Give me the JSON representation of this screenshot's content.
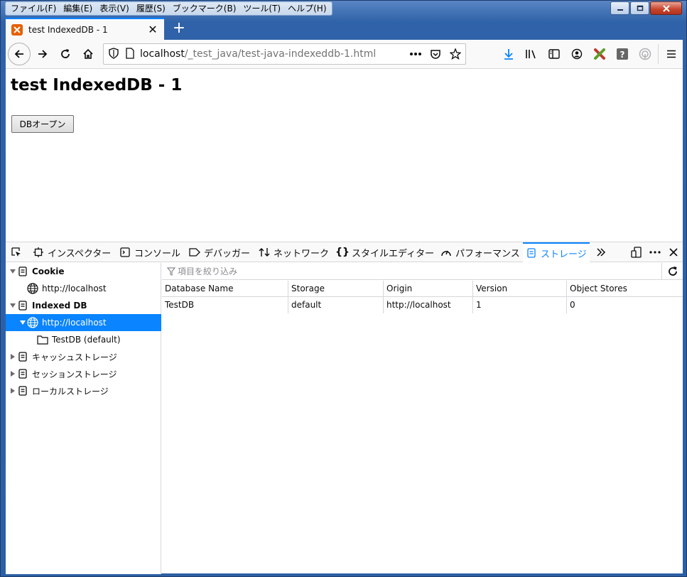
{
  "menu": [
    "ファイル(F)",
    "編集(E)",
    "表示(V)",
    "履歴(S)",
    "ブックマーク(B)",
    "ツール(T)",
    "ヘルプ(H)"
  ],
  "tab": {
    "title": "test IndexedDB - 1"
  },
  "url": {
    "host": "localhost",
    "path": "/_test_java/test-java-indexeddb-1.html"
  },
  "page": {
    "heading": "test IndexedDB - 1",
    "button_label": "DBオープン"
  },
  "devtools": {
    "tabs": [
      "インスペクター",
      "コンソール",
      "デバッガー",
      "ネットワーク",
      "スタイルエディター",
      "パフォーマンス",
      "ストレージ"
    ],
    "active_tab": "ストレージ",
    "tree": [
      {
        "label": "Cookie",
        "level": 0,
        "expanded": true,
        "icon": "storage-icon"
      },
      {
        "label": "http://localhost",
        "level": 1,
        "icon": "globe-icon"
      },
      {
        "label": "Indexed DB",
        "level": 0,
        "expanded": true,
        "icon": "storage-icon"
      },
      {
        "label": "http://localhost",
        "level": 1,
        "expanded": true,
        "selected": true,
        "icon": "globe-icon"
      },
      {
        "label": "TestDB (default)",
        "level": 2,
        "icon": "folder-icon"
      },
      {
        "label": "キャッシュストレージ",
        "level": 0,
        "expanded": false,
        "icon": "storage-icon"
      },
      {
        "label": "セッションストレージ",
        "level": 0,
        "expanded": false,
        "icon": "storage-icon"
      },
      {
        "label": "ローカルストレージ",
        "level": 0,
        "expanded": false,
        "icon": "storage-icon"
      }
    ],
    "filter_placeholder": "項目を絞り込み",
    "table": {
      "columns": [
        "Database Name",
        "Storage",
        "Origin",
        "Version",
        "Object Stores"
      ],
      "rows": [
        [
          "TestDB",
          "default",
          "http://localhost",
          "1",
          "0"
        ]
      ]
    }
  },
  "colors": {
    "accent": "#0a84ff",
    "titlebar": "#2b5797"
  }
}
